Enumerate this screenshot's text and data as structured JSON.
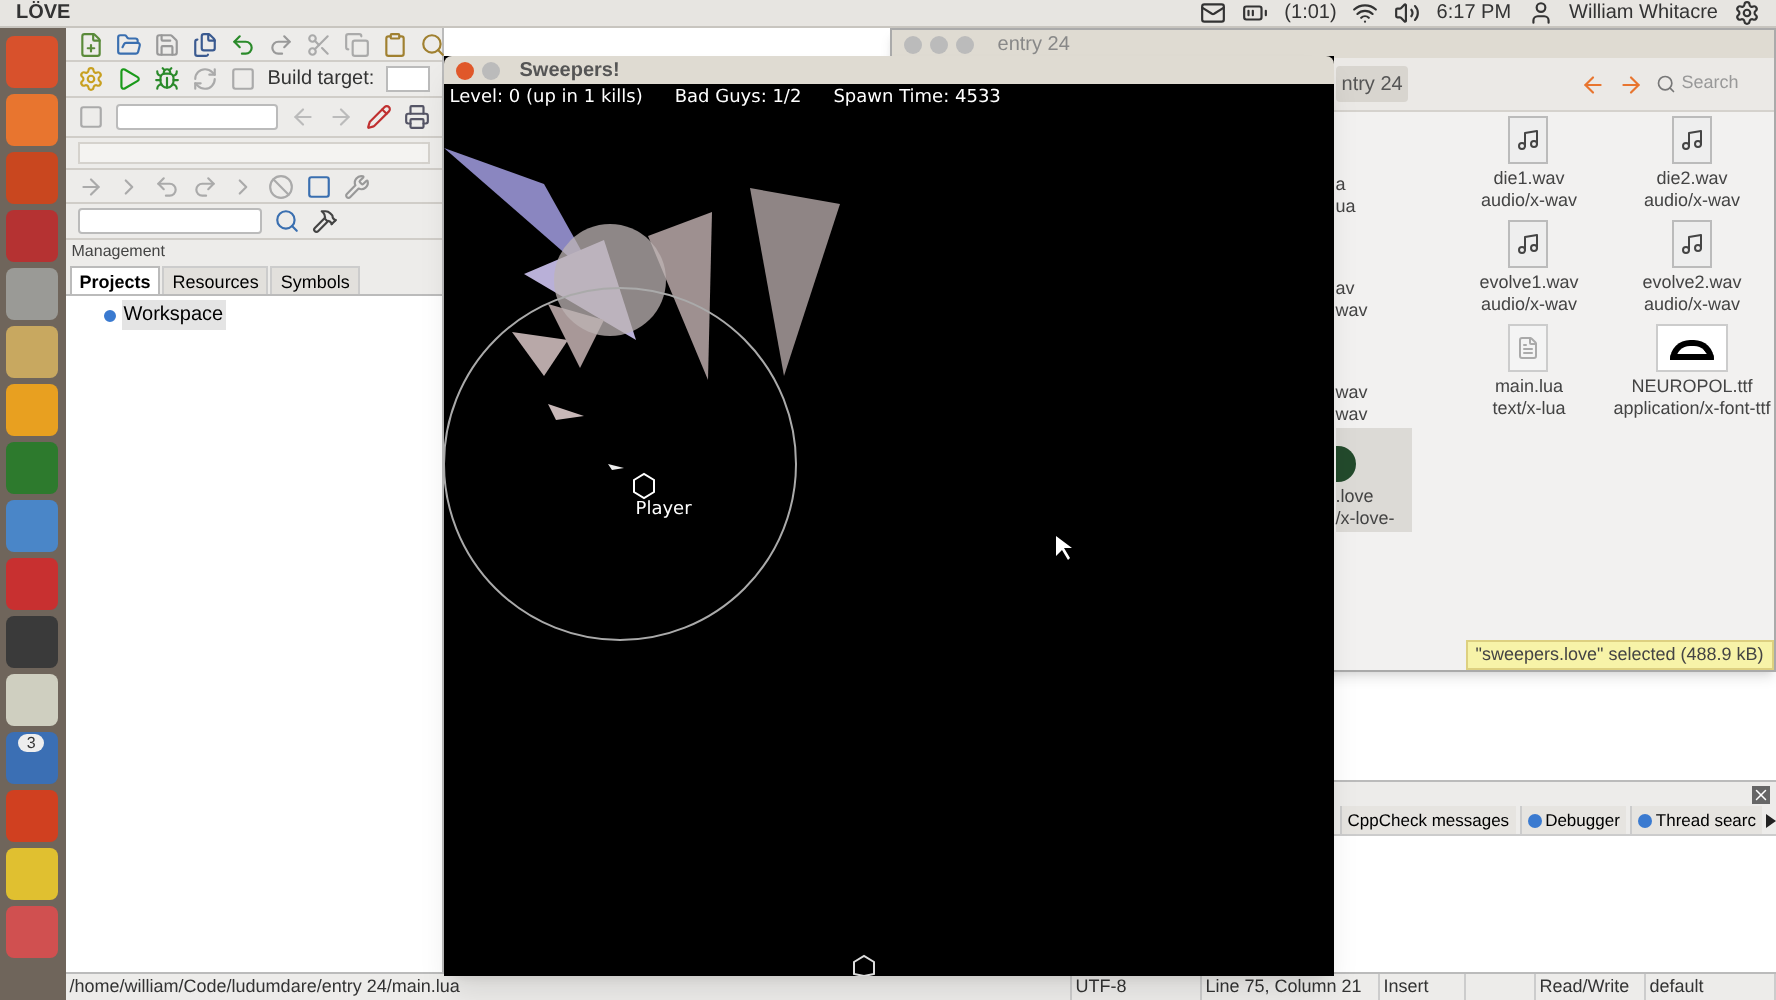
{
  "top_panel": {
    "app_name": "LÖVE",
    "battery": "(1:01)",
    "clock": "6:17 PM",
    "user": "William Whitacre"
  },
  "launcher": {
    "badge": "3"
  },
  "ide": {
    "build_target_label": "Build target:",
    "management": {
      "title": "Management",
      "tabs": [
        {
          "label": "Projects",
          "selected": true
        },
        {
          "label": "Resources",
          "selected": false
        },
        {
          "label": "Symbols",
          "selected": false
        }
      ],
      "tree": [
        {
          "label": "Workspace",
          "selected": true
        }
      ]
    },
    "logs": {
      "tabs": [
        {
          "label": "CppCheck messages",
          "selected": false
        },
        {
          "label": "Debugger",
          "selected": false
        },
        {
          "label": "Thread searc",
          "selected": false
        }
      ]
    },
    "status_bar": [
      "/home/william/Code/ludumdare/entry 24/main.lua",
      "UTF-8",
      "Line 75, Column 21",
      "Insert",
      "Read/Write",
      "default"
    ]
  },
  "file_manager": {
    "title": "entry 24",
    "path_button": "ntry 24",
    "search_placeholder": "Search",
    "cut_items": [
      {
        "name": "a",
        "type": "ua",
        "kind": "hidden",
        "selected": false
      },
      {
        "name": "av",
        "type": "wav",
        "kind": "hidden",
        "selected": false
      },
      {
        "name": "wav",
        "type": "wav",
        "kind": "hidden",
        "selected": false
      },
      {
        "name": ".love",
        "type": "/x-love-",
        "kind": "love",
        "selected": true
      }
    ],
    "files": [
      {
        "name": "die1.wav",
        "type": "audio/x-wav",
        "kind": "audio",
        "selected": false
      },
      {
        "name": "die2.wav",
        "type": "audio/x-wav",
        "kind": "audio",
        "selected": false
      },
      {
        "name": "evolve1.wav",
        "type": "audio/x-wav",
        "kind": "audio",
        "selected": false
      },
      {
        "name": "evolve2.wav",
        "type": "audio/x-wav",
        "kind": "audio",
        "selected": false
      },
      {
        "name": "main.lua",
        "type": "text/x-lua",
        "kind": "text",
        "selected": false
      },
      {
        "name": "NEUROPOL.ttf",
        "type": "application/x-font-ttf",
        "kind": "font",
        "selected": false
      }
    ],
    "status": "\"sweepers.love\" selected (488.9 kB)"
  },
  "game": {
    "title": "Sweepers!",
    "hud": [
      "Level: 0 (up in 1 kills)",
      "Bad Guys: 1/2",
      "Spawn Time: 4533"
    ],
    "player_label": "Player"
  }
}
